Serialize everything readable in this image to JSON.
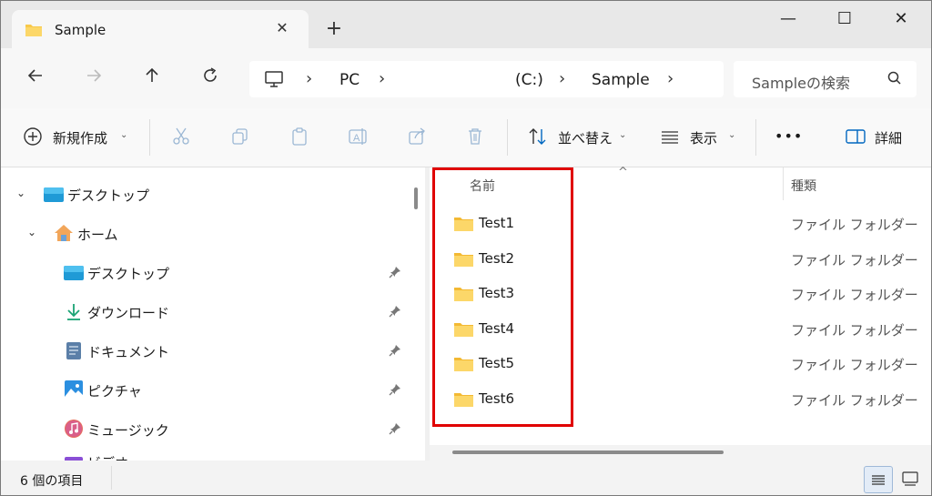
{
  "window": {
    "tab_title": "Sample",
    "tab_close": "✕",
    "new_tab": "+",
    "minimize": "—",
    "maximize": "☐",
    "close": "✕"
  },
  "address": {
    "crumbs": [
      "PC",
      "(C:)",
      "Sample"
    ],
    "search_placeholder": "Sampleの検索"
  },
  "commands": {
    "new": "新規作成",
    "sort": "並べ替え",
    "view": "表示",
    "more": "•••",
    "details": "詳細"
  },
  "nav_tree": [
    {
      "label": "デスクトップ",
      "icon": "desktop-icon"
    },
    {
      "label": "ホーム",
      "icon": "home-icon"
    },
    {
      "label": "デスクトップ",
      "icon": "desktop-icon"
    },
    {
      "label": "ダウンロード",
      "icon": "download-icon"
    },
    {
      "label": "ドキュメント",
      "icon": "document-icon"
    },
    {
      "label": "ピクチャ",
      "icon": "pictures-icon"
    },
    {
      "label": "ミュージック",
      "icon": "music-icon"
    },
    {
      "label": "ビデオ",
      "icon": "video-icon"
    }
  ],
  "file_list": {
    "columns": {
      "name": "名前",
      "type": "種類"
    },
    "sort_indicator": "^",
    "rows": [
      {
        "name": "Test1",
        "type": "ファイル フォルダー"
      },
      {
        "name": "Test2",
        "type": "ファイル フォルダー"
      },
      {
        "name": "Test3",
        "type": "ファイル フォルダー"
      },
      {
        "name": "Test4",
        "type": "ファイル フォルダー"
      },
      {
        "name": "Test5",
        "type": "ファイル フォルダー"
      },
      {
        "name": "Test6",
        "type": "ファイル フォルダー"
      }
    ]
  },
  "status": {
    "item_count": "6 個の項目"
  },
  "colors": {
    "highlight_box": "#e00000",
    "folder_yellow": "#f8c94a",
    "accent": "#0067c0"
  }
}
